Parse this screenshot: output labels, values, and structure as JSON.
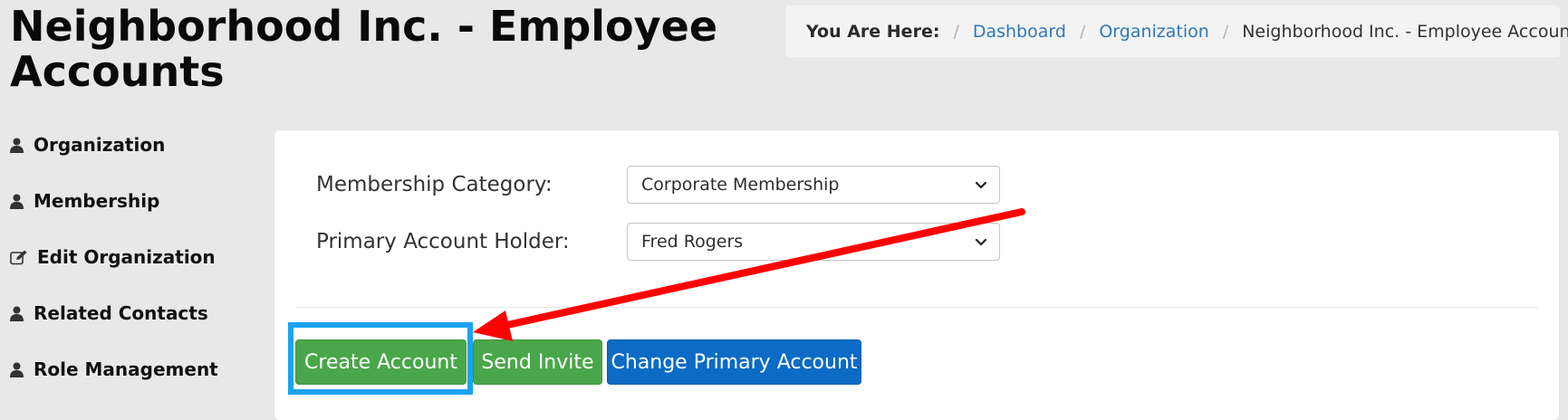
{
  "header": {
    "title": "Neighborhood Inc. - Employee Accounts"
  },
  "breadcrumb": {
    "label": "You Are Here:",
    "separator": "/",
    "items": [
      {
        "label": "Dashboard",
        "link": true
      },
      {
        "label": "Organization",
        "link": true
      },
      {
        "label": "Neighborhood Inc. - Employee Accounts",
        "link": false
      }
    ]
  },
  "sidebar": {
    "items": [
      {
        "label": "Organization",
        "icon": "user-icon"
      },
      {
        "label": "Membership",
        "icon": "user-icon"
      },
      {
        "label": "Edit Organization",
        "icon": "edit-icon"
      },
      {
        "label": "Related Contacts",
        "icon": "user-icon"
      },
      {
        "label": "Role Management",
        "icon": "user-icon"
      }
    ]
  },
  "form": {
    "membership_category": {
      "label": "Membership Category:",
      "value": "Corporate Membership"
    },
    "primary_account_holder": {
      "label": "Primary Account Holder:",
      "value": "Fred Rogers"
    }
  },
  "actions": {
    "create_account": "Create Account",
    "send_invite": "Send Invite",
    "change_primary": "Change Primary Account"
  },
  "colors": {
    "page_bg": "#e8e8e8",
    "link": "#2f78b9",
    "green_button": "#4aa64a",
    "blue_button": "#0b6bc5",
    "annotation_highlight": "#1aa3ee",
    "annotation_arrow": "#ff0000"
  }
}
